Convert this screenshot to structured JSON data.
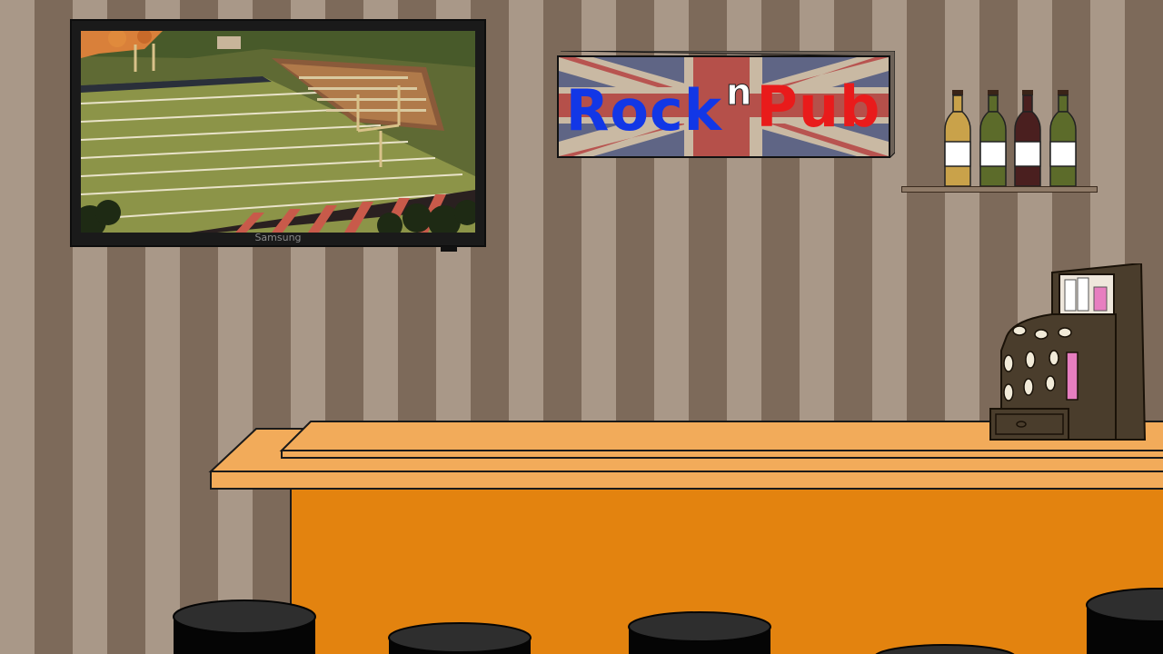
{
  "scene": {
    "name": "pub-interior",
    "tv": {
      "brand": "Samsung",
      "screen_content": "football-stadium"
    },
    "sign": {
      "word1": "Rock",
      "word2": "n",
      "word3": "Pub"
    },
    "shelf": {
      "bottles": [
        {
          "color": "#c9a24a"
        },
        {
          "color": "#5c6b2a"
        },
        {
          "color": "#4a1f1f"
        },
        {
          "color": "#5c6b2a"
        }
      ]
    },
    "colors": {
      "bar_front": "#e3830f",
      "bar_top": "#f2ab5a",
      "stool_seat": "#2e2e2e",
      "register_body": "#4a3d2c",
      "register_pink": "#e77ec0"
    },
    "icons": [
      "tv-icon",
      "bottle-icon",
      "cash-register-icon",
      "stool-icon"
    ]
  }
}
